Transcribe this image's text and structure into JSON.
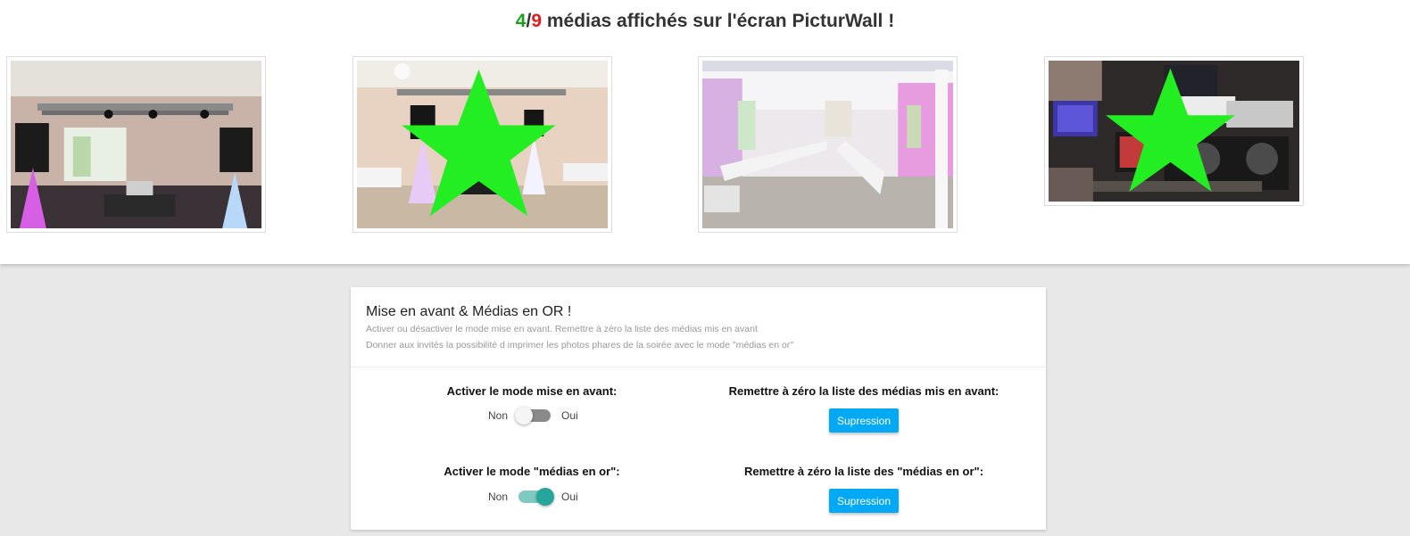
{
  "header": {
    "shown_count": "4",
    "separator": "/",
    "total_count": "9",
    "headline_text": " médias affichés sur l'écran PicturWall !",
    "colors": {
      "shown": "#1aa11a",
      "total": "#e01b1b"
    }
  },
  "gallery": {
    "items": [
      {
        "description": "salle avec structure lumineuse et enceintes",
        "featured": false
      },
      {
        "description": "DJ derrière la table, salle carrelée",
        "featured": true
      },
      {
        "description": "salle de réception avec tables dressées",
        "featured": false
      },
      {
        "description": "matériel DJ, ordinateurs et contrôleurs",
        "featured": true
      }
    ],
    "star_color": "#22ee22"
  },
  "panel": {
    "title": "Mise en avant & Médias en OR !",
    "desc_line1": "Activer ou désactiver le mode mise en avant. Remettre à zéro la liste des médias mis en avant",
    "desc_line2": "Donner aux invités la possibilité d imprimer les photos phares de la soirée avec le mode \"médias en or\"",
    "featured_mode": {
      "label": "Activer le mode mise en avant:",
      "off_label": "Non",
      "on_label": "Oui",
      "enabled": false
    },
    "featured_reset": {
      "label": "Remettre à zéro la liste des médias mis en avant:",
      "button": "Supression"
    },
    "gold_mode": {
      "label": "Activer le mode \"médias en or\":",
      "off_label": "Non",
      "on_label": "Oui",
      "enabled": true
    },
    "gold_reset": {
      "label": "Remettre à zéro la liste des \"médias en or\":",
      "button": "Supression"
    },
    "colors": {
      "accent": "#03a9f4",
      "toggle_on": "#26a69a"
    }
  }
}
